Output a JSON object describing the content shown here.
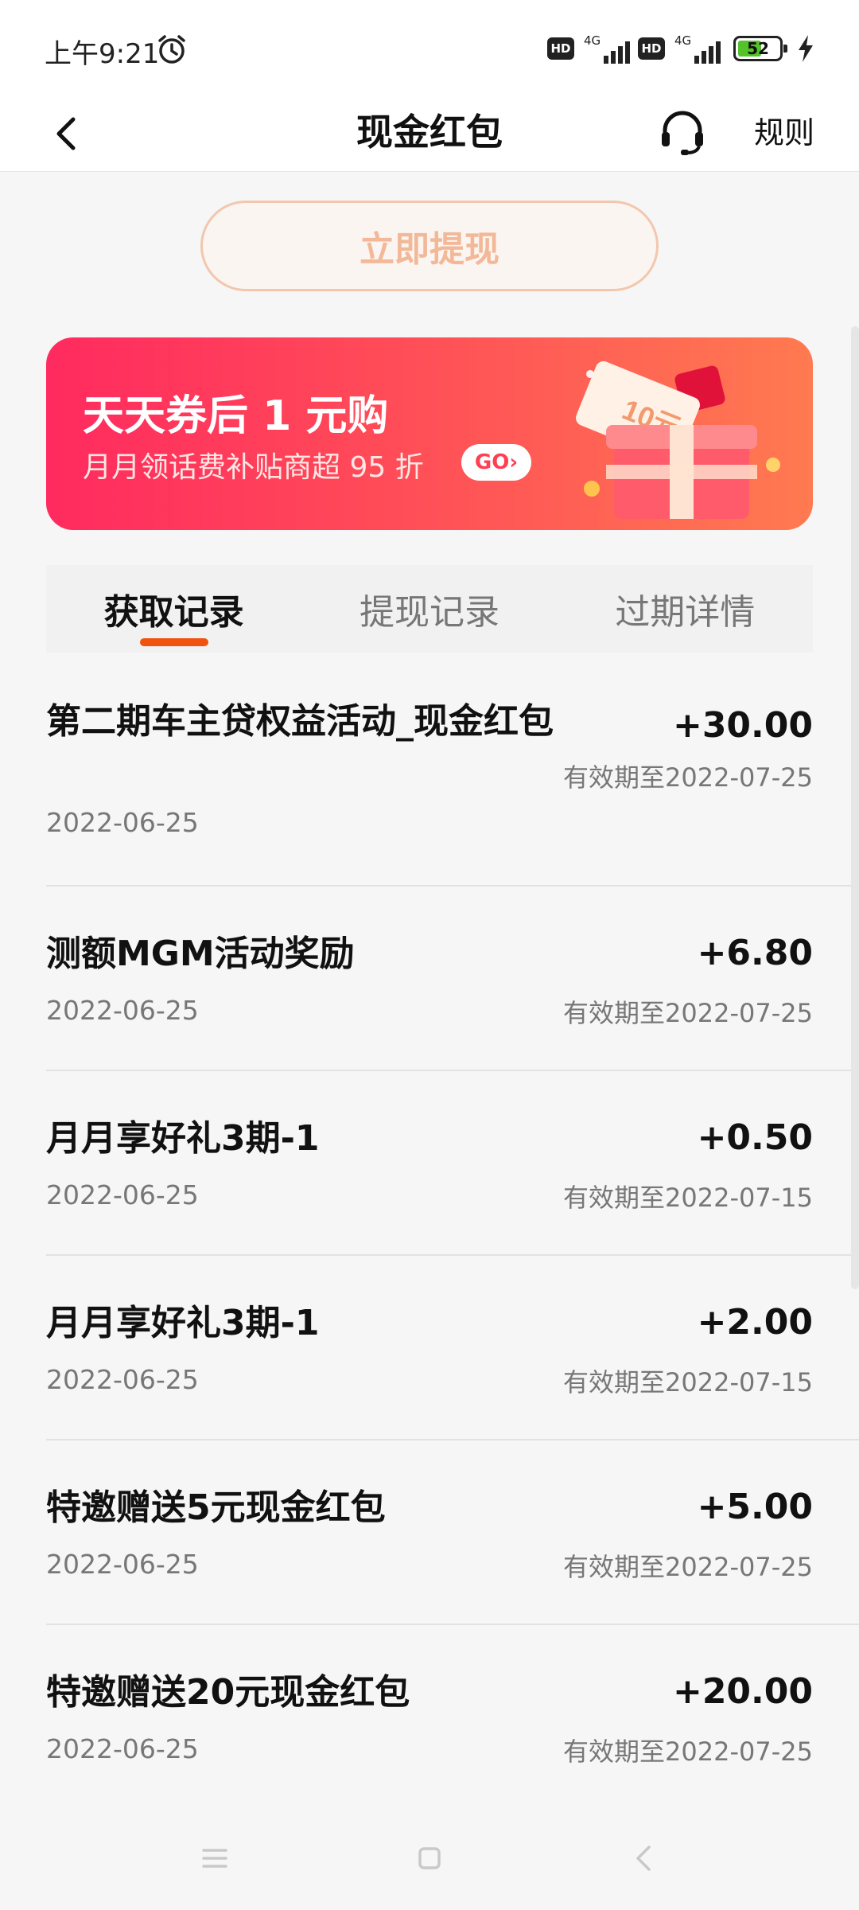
{
  "status_bar": {
    "time": "上午9:21",
    "network_1": "4G",
    "network_2": "4G",
    "hd_label": "HD",
    "battery": "52",
    "icons": [
      "alarm-icon",
      "hd-icon",
      "signal-icon",
      "battery-icon",
      "charging-bolt-icon"
    ]
  },
  "header": {
    "title": "现金红包",
    "rules_label": "规则",
    "icons": [
      "back-arrow-icon",
      "headset-icon"
    ]
  },
  "withdraw_button": {
    "label": "立即提现"
  },
  "banner": {
    "title": "天天券后 1 元购",
    "subtitle": "月月领话费补贴商超 95 折",
    "go_label": "GO",
    "illustration_text": "10元",
    "colors": {
      "start": "#ff2a5f",
      "end": "#ff7a50"
    }
  },
  "tabs": [
    {
      "label": "获取记录",
      "active": true
    },
    {
      "label": "提现记录",
      "active": false
    },
    {
      "label": "过期详情",
      "active": false
    }
  ],
  "accent_color": "#f1520e",
  "records": [
    {
      "title": "第二期车主贷权益活动_现金红包",
      "date": "2022-06-25",
      "amount": "+30.00",
      "expiry": "有效期至2022-07-25"
    },
    {
      "title": "测额MGM活动奖励",
      "date": "2022-06-25",
      "amount": "+6.80",
      "expiry": "有效期至2022-07-25"
    },
    {
      "title": "月月享好礼3期-1",
      "date": "2022-06-25",
      "amount": "+0.50",
      "expiry": "有效期至2022-07-15"
    },
    {
      "title": "月月享好礼3期-1",
      "date": "2022-06-25",
      "amount": "+2.00",
      "expiry": "有效期至2022-07-15"
    },
    {
      "title": "特邀赠送5元现金红包",
      "date": "2022-06-25",
      "amount": "+5.00",
      "expiry": "有效期至2022-07-25"
    },
    {
      "title": "特邀赠送20元现金红包",
      "date": "2022-06-25",
      "amount": "+20.00",
      "expiry": "有效期至2022-07-25"
    }
  ],
  "nav_bar": {
    "icons": [
      "menu-icon",
      "home-icon",
      "back-icon"
    ]
  }
}
